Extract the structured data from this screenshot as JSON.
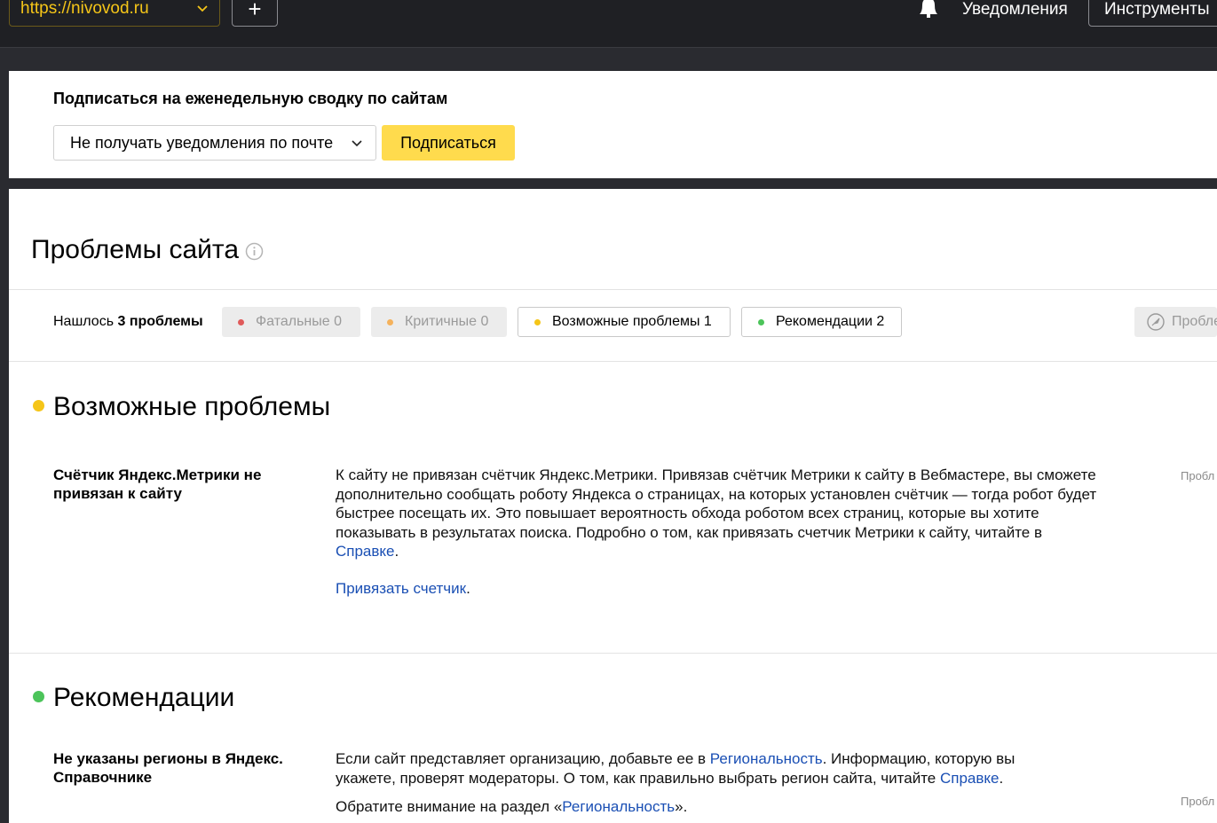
{
  "topbar": {
    "site_url": "https://nivovod.ru",
    "add_label": "+",
    "notifications_label": "Уведомления",
    "tools_label": "Инструменты"
  },
  "subscribe": {
    "title": "Подписаться на еженедельную сводку по сайтам",
    "selected_option": "Не получать уведомления по почте",
    "button_label": "Подписаться"
  },
  "problems": {
    "title": "Проблемы сайта",
    "found_prefix": "Нашлось",
    "found_count": "3 проблемы",
    "filters": [
      {
        "label": "Фатальные",
        "count": "0",
        "color": "#e05a5a"
      },
      {
        "label": "Критичные",
        "count": "0",
        "color": "#f5b25c"
      },
      {
        "label": "Возможные проблемы",
        "count": "1",
        "color": "#f5c518"
      },
      {
        "label": "Рекомендации",
        "count": "2",
        "color": "#4cc45a"
      }
    ],
    "rocket_label": "Пробле"
  },
  "sections": [
    {
      "title": "Возможные проблемы",
      "color": "#f5c518",
      "issues": [
        {
          "title": "Счётчик Яндекс.Метрики не привязан к сайту",
          "text_before": "К сайту не привязан счётчик Яндекс.Метрики. Привязав счётчик Метрики к сайту в Вебмастере, вы сможете дополнительно сообщать роботу Яндекса о страницах, на которых установлен счётчик — тогда робот будет быстрее посещать их. Это повышает вероятность обхода роботом всех страниц, которые вы хотите показывать в результатах поиска. Подробно о том, как привязать счетчик Метрики к сайту, читайте в ",
          "help_link": "Справке",
          "text_after": ".",
          "action_link": "Привязать счетчик",
          "action_after": ".",
          "side_label": "Пробл"
        }
      ]
    },
    {
      "title": "Рекомендации",
      "color": "#4cc45a",
      "issues": [
        {
          "title": "Не указаны регионы в Яндекс. Справочнике",
          "text_part1": "Если сайт представляет организацию, добавьте ее в ",
          "link1": "Региональность",
          "text_part2": ". Информацию, которую вы укажете, проверят модераторы. О том, как правильно выбрать регион сайта, читайте ",
          "link2": "Справке",
          "text_part3": ".",
          "note_before": "Обратите внимание на раздел «",
          "note_link": "Региональность",
          "note_after": "».",
          "side_label": "Пробл"
        }
      ]
    }
  ]
}
